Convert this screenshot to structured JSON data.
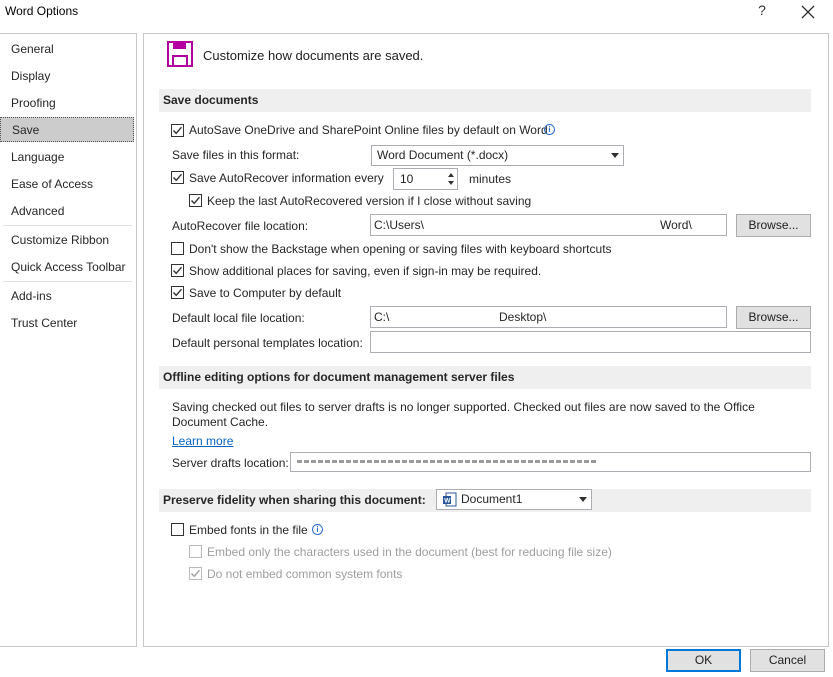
{
  "window": {
    "title": "Word Options",
    "help_symbol": "?",
    "close_symbol": "✕"
  },
  "sidebar": {
    "items": [
      {
        "label": "General"
      },
      {
        "label": "Display"
      },
      {
        "label": "Proofing"
      },
      {
        "label": "Save",
        "selected": true
      },
      {
        "label": "Language"
      },
      {
        "label": "Ease of Access"
      },
      {
        "label": "Advanced"
      },
      {
        "label": "Customize Ribbon"
      },
      {
        "label": "Quick Access Toolbar"
      },
      {
        "label": "Add-ins"
      },
      {
        "label": "Trust Center"
      }
    ]
  },
  "header": {
    "text": "Customize how documents are saved.",
    "icon": "save-icon",
    "icon_color": "#b4009e"
  },
  "save_documents": {
    "title": "Save documents",
    "autosave_label": "AutoSave OneDrive and SharePoint Online files by default on Word",
    "autosave_checked": true,
    "format_label": "Save files in this format:",
    "format_value": "Word Document (*.docx)",
    "autorecover_label": "Save AutoRecover information every",
    "autorecover_checked": true,
    "autorecover_minutes": "10",
    "minutes_label": "minutes",
    "keep_last_label": "Keep the last AutoRecovered version if I close without saving",
    "keep_last_checked": true,
    "autorecover_location_label": "AutoRecover file location:",
    "autorecover_location_start": "C:\\Users\\",
    "autorecover_location_end": "Word\\",
    "browse_label": "Browse...",
    "dont_show_backstage_label": "Don't show the Backstage when opening or saving files with keyboard shortcuts",
    "dont_show_backstage_checked": false,
    "show_additional_label": "Show additional places for saving, even if sign-in may be required.",
    "show_additional_checked": true,
    "save_to_computer_label": "Save to Computer by default",
    "save_to_computer_checked": true,
    "default_local_label": "Default local file location:",
    "default_local_start": "C:\\",
    "default_local_end": "Desktop\\",
    "templates_label": "Default personal templates location:",
    "templates_value": ""
  },
  "offline": {
    "title": "Offline editing options for document management server files",
    "notice": "Saving checked out files to server drafts is no longer supported. Checked out files are now saved to the Office Document Cache.",
    "learn_more": "Learn more",
    "server_drafts_label": "Server drafts location:"
  },
  "fidelity": {
    "title": "Preserve fidelity when sharing this document:",
    "document": "Document1",
    "embed_fonts_label": "Embed fonts in the file",
    "embed_fonts_checked": false,
    "embed_only_label": "Embed only the characters used in the document (best for reducing file size)",
    "embed_only_checked": false,
    "no_common_label": "Do not embed common system fonts",
    "no_common_checked": true
  },
  "footer": {
    "ok_label": "OK",
    "cancel_label": "Cancel"
  },
  "colors": {
    "accent": "#0078d7",
    "selected_nav": "#cccccc",
    "section_header": "#efefef"
  }
}
